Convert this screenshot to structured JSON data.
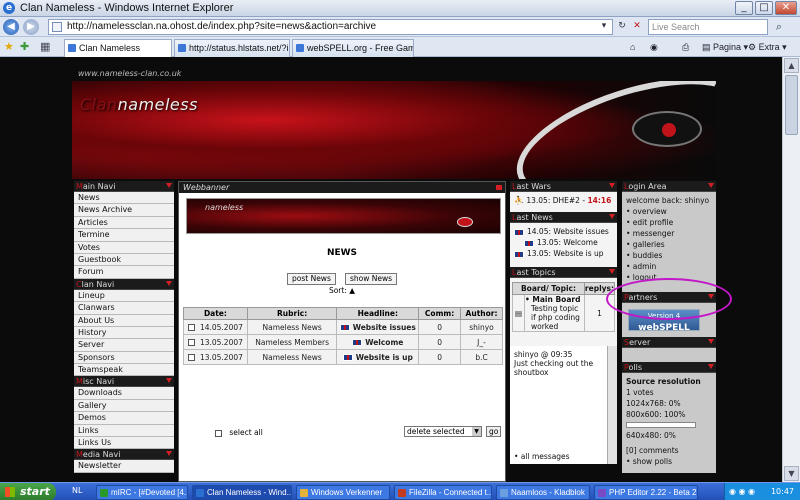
{
  "window": {
    "title": "Clan Nameless - Windows Internet Explorer",
    "minimize": "_",
    "maximize": "□",
    "close": "✕"
  },
  "addressbar": {
    "url": "http://namelessclan.na.ohost.de/index.php?site=news&action=archive",
    "search_placeholder": "Live Search"
  },
  "tabs": [
    {
      "label": "Clan Nameless",
      "active": true
    },
    {
      "label": "http://status.hlstats.net/?ip..."
    },
    {
      "label": "webSPELL.org - Free Gaming..."
    }
  ],
  "toolbar": {
    "page_label": "Pagina",
    "extra_label": "Extra"
  },
  "site": {
    "url_text": "www.nameless-clan.co.uk",
    "logo_first": "Clan",
    "logo_rest": "nameless"
  },
  "leftnav": {
    "main_head_first": "M",
    "main_head_rest": "ain Navi",
    "main_items": [
      "News",
      "News Archive",
      "Articles",
      "Termine",
      "Votes",
      "Guestbook",
      "Forum"
    ],
    "clan_head_first": "C",
    "clan_head_rest": "lan Navi",
    "clan_items": [
      "Lineup",
      "Clanwars",
      "About Us",
      "History",
      "Server",
      "Sponsors",
      "Teamspeak"
    ],
    "misc_head_first": "M",
    "misc_head_rest": "isc Navi",
    "misc_items": [
      "Downloads",
      "Gallery",
      "Demos",
      "Links",
      "Links Us"
    ],
    "media_head_first": "M",
    "media_head_rest": "edia Navi",
    "media_items": [
      "Newsletter"
    ]
  },
  "center": {
    "head": "Webbanner",
    "banner_text": "nameless",
    "news_title": "NEWS",
    "post_news": "post News",
    "show_news": "show News",
    "sort_label": "Sort:",
    "sort_icon": "▲",
    "columns": [
      "Date:",
      "Rubric:",
      "Headline:",
      "Comm:",
      "Author:"
    ],
    "rows": [
      {
        "date": "14.05.2007",
        "rubric": "Nameless News",
        "headline": "Website issues",
        "comm": "0",
        "author": "shinyo"
      },
      {
        "date": "13.05.2007",
        "rubric": "Nameless Members",
        "headline": "Welcome",
        "comm": "0",
        "author": "J_-"
      },
      {
        "date": "13.05.2007",
        "rubric": "Nameless News",
        "headline": "Website is up",
        "comm": "0",
        "author": "b.C"
      }
    ],
    "select_all": "select all",
    "delete_selected": "delete selected",
    "go": "go"
  },
  "col2": {
    "lastwars_first": "L",
    "lastwars_rest": "ast Wars",
    "war_line": "13.05: DHE#2 -",
    "war_time": "14:16",
    "lastnews_first": "L",
    "lastnews_rest": "ast News",
    "news_lines": [
      "14.05: Website issues",
      "13.05: Welcome",
      "13.05: Website is up"
    ],
    "lasttopics_first": "L",
    "lasttopics_rest": "ast Topics",
    "topic_col1": "Board/ Topic:",
    "topic_col2": "replys:",
    "topic_board": "• Main Board",
    "topic_title": "Testing topic if php coding worked",
    "topic_replys": "1",
    "shout_user": "shinyo @ 09:35",
    "shout_text": "Just checking out the shoutbox",
    "all_messages": "• all messages"
  },
  "col3": {
    "login_first": "L",
    "login_rest": "ogin Area",
    "welcome": "welcome back: shinyo",
    "links": [
      "• overview",
      "• edit profile",
      "• messenger",
      "• galleries",
      "• buddies",
      "• admin",
      "• logout"
    ],
    "partners_first": "P",
    "partners_rest": "artners",
    "partner_badge_top": "Version 4",
    "partner_badge_name": "webSPELL",
    "server_first": "S",
    "server_rest": "erver",
    "polls_first": "P",
    "polls_rest": "olls",
    "poll_title": "Source resolution",
    "poll_votes": "1 votes",
    "poll_options": [
      "1024x768: 0%",
      "800x600: 100%",
      "640x480: 0%"
    ],
    "poll_percents": [
      0,
      100,
      0
    ],
    "poll_comments": "[0] comments",
    "show_polls": "• show polls"
  },
  "taskbar": {
    "start": "start",
    "lang": "NL",
    "items": [
      {
        "label": "mIRC - [#Devoted [4...",
        "color": "#2a9a2a"
      },
      {
        "label": "Clan Nameless - Wind...",
        "color": "#2b6fd1",
        "active": true
      },
      {
        "label": "Windows Verkenner",
        "color": "#e3b23a"
      },
      {
        "label": "FileZilla - Connected t...",
        "color": "#c23b22"
      },
      {
        "label": "Naamloos - Kladblok",
        "color": "#6aa0e0"
      },
      {
        "label": "PHP Editor 2.22 - Beta 2",
        "color": "#7a4bc2"
      }
    ],
    "clock": "10:47"
  },
  "colors": {
    "accent_red": "#c0131a",
    "highlight_magenta": "#c218c8"
  }
}
